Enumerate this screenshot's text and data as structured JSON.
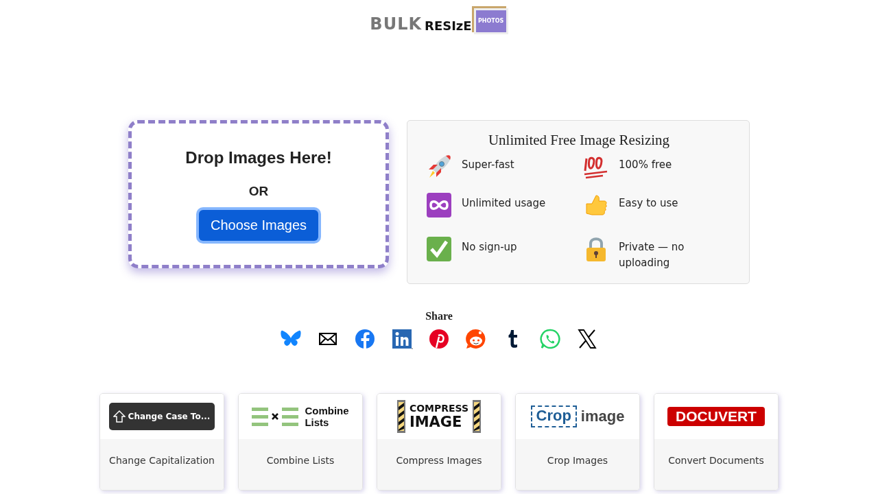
{
  "logo": {
    "word_1": "BULK",
    "word_2": "RESIzE",
    "badge": "PHOTOS"
  },
  "dropzone": {
    "title": "Drop Images Here!",
    "separator": "OR",
    "button": "Choose Images"
  },
  "features": {
    "title": "Unlimited Free Image Resizing",
    "items": [
      {
        "kind": "rocket",
        "label": "Super-fast"
      },
      {
        "kind": "hundred",
        "label": "100% free"
      },
      {
        "kind": "infinity",
        "label": "Unlimited usage"
      },
      {
        "kind": "thumb",
        "label": "Easy to use"
      },
      {
        "kind": "check",
        "label": "No sign-up"
      },
      {
        "kind": "lock",
        "label": "Private — no uploading"
      }
    ]
  },
  "share": {
    "title": "Share",
    "icons": [
      {
        "kind": "bluesky"
      },
      {
        "kind": "email"
      },
      {
        "kind": "facebook"
      },
      {
        "kind": "linkedin"
      },
      {
        "kind": "pinterest"
      },
      {
        "kind": "reddit"
      },
      {
        "kind": "tumblr"
      },
      {
        "kind": "whatsapp"
      },
      {
        "kind": "x"
      }
    ]
  },
  "tools": [
    {
      "kind": "case",
      "banner": [
        "Change Case To..."
      ],
      "label": "Change Capitalization"
    },
    {
      "kind": "lists",
      "banner": [
        "Combine",
        "Lists"
      ],
      "label": "Combine Lists"
    },
    {
      "kind": "compress",
      "banner": [
        "COMPRESS",
        "IMAGE"
      ],
      "label": "Compress Images"
    },
    {
      "kind": "crop",
      "banner": [
        "Crop",
        "image"
      ],
      "label": "Crop Images"
    },
    {
      "kind": "docuvert",
      "banner": [
        "DOCUVERT"
      ],
      "label": "Convert Documents"
    }
  ]
}
